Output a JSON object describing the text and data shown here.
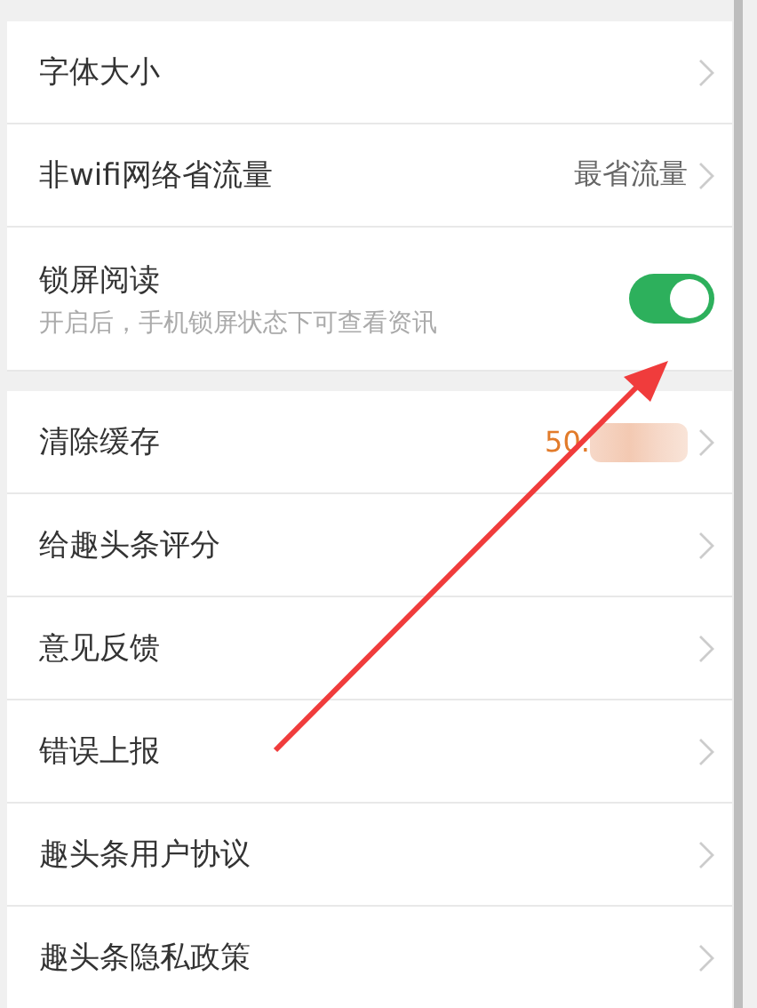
{
  "groups": [
    {
      "rows": [
        {
          "kind": "link",
          "label": "字体大小"
        },
        {
          "kind": "link",
          "label": "非wifi网络省流量",
          "value": "最省流量"
        },
        {
          "kind": "toggle",
          "label": "锁屏阅读",
          "sublabel": "开启后，手机锁屏状态下可查看资讯",
          "on": true
        }
      ]
    },
    {
      "rows": [
        {
          "kind": "link",
          "label": "清除缓存",
          "value": "50.",
          "blurred": true
        },
        {
          "kind": "link",
          "label": "给趣头条评分"
        },
        {
          "kind": "link",
          "label": "意见反馈"
        },
        {
          "kind": "link",
          "label": "错误上报"
        },
        {
          "kind": "link",
          "label": "趣头条用户协议"
        },
        {
          "kind": "link",
          "label": "趣头条隐私政策"
        }
      ]
    }
  ]
}
